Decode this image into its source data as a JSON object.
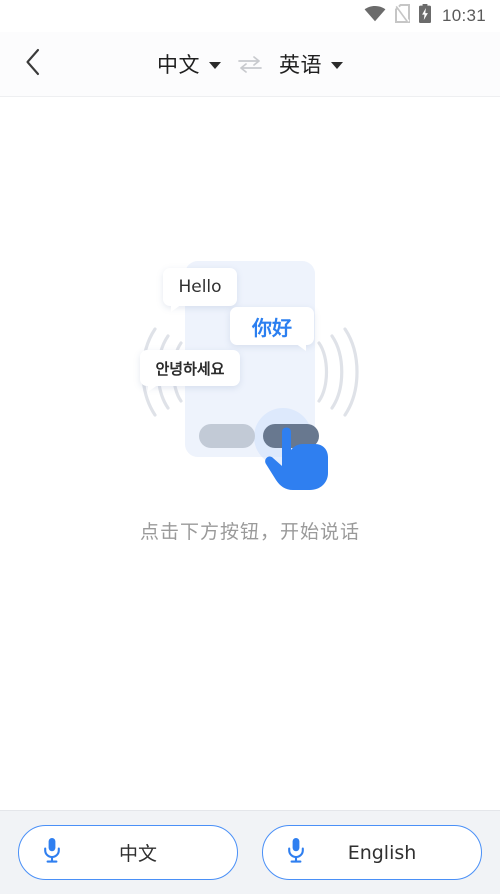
{
  "statusbar": {
    "time": "10:31",
    "icons": [
      "wifi-icon",
      "no-sim-icon",
      "battery-charging-icon"
    ]
  },
  "header": {
    "back_icon": "chevron-left-icon",
    "source_language": "中文",
    "target_language": "英语",
    "swap_icon": "swap-horizontal-icon",
    "caret_icon": "caret-down-icon"
  },
  "main": {
    "illustration": {
      "name": "speech-translate-illustration",
      "bubbles": [
        {
          "text": "Hello",
          "lang": "en"
        },
        {
          "text": "你好",
          "lang": "zh"
        },
        {
          "text": "안녕하세요",
          "lang": "ko"
        }
      ],
      "hand_icon": "pointing-hand-icon",
      "sound_wave_icon": "sound-waves-icon"
    },
    "hint": "点击下方按钮，开始说话"
  },
  "bottombar": {
    "buttons": [
      {
        "label": "中文",
        "icon": "microphone-icon"
      },
      {
        "label": "English",
        "icon": "microphone-icon"
      }
    ]
  },
  "colors": {
    "accent_blue": "#2b7ff0",
    "button_border": "#4a90f7",
    "bottom_bar_bg": "#f1f3f6",
    "hint_text": "#9a9a9a",
    "page_bg": "#ffffff"
  }
}
